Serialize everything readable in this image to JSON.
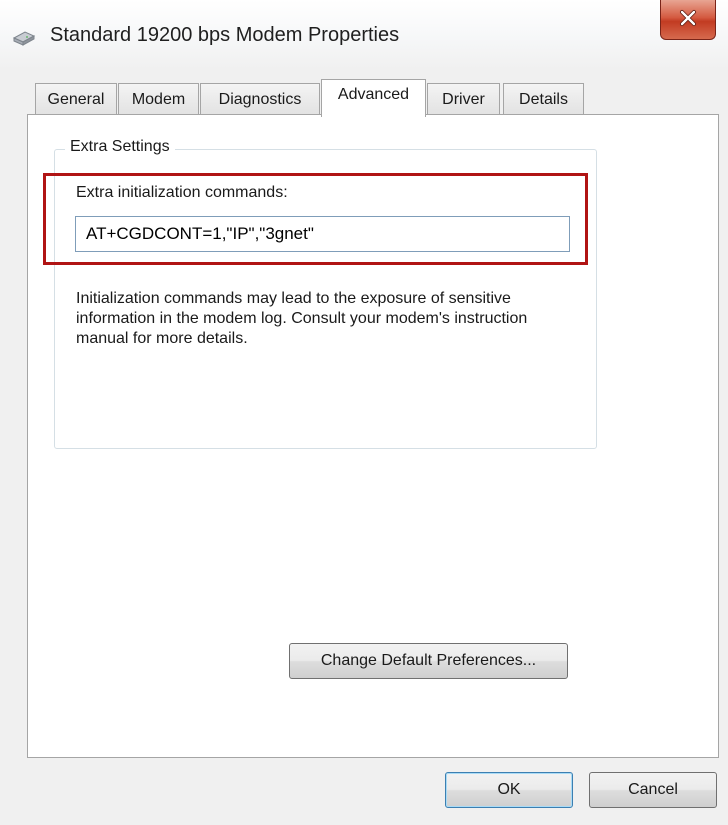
{
  "window": {
    "title": "Standard 19200 bps Modem Properties",
    "icon": "modem-icon",
    "close_icon": "close-icon"
  },
  "tabs": [
    {
      "label": "General",
      "active": false
    },
    {
      "label": "Modem",
      "active": false
    },
    {
      "label": "Diagnostics",
      "active": false
    },
    {
      "label": "Advanced",
      "active": true
    },
    {
      "label": "Driver",
      "active": false
    },
    {
      "label": "Details",
      "active": false
    }
  ],
  "extra_settings": {
    "group_label": "Extra Settings",
    "field_label": "Extra initialization commands:",
    "field_value": "AT+CGDCONT=1,\"IP\",\"3gnet\"",
    "warning": "Initialization commands may lead to the exposure of sensitive information in the modem log. Consult your modem's instruction manual for more details."
  },
  "buttons": {
    "change_prefs": "Change Default Preferences...",
    "ok": "OK",
    "cancel": "Cancel"
  },
  "colors": {
    "highlight_border": "#b01414",
    "close_button": "#c23b22",
    "default_button_border": "#3c7fb1"
  }
}
